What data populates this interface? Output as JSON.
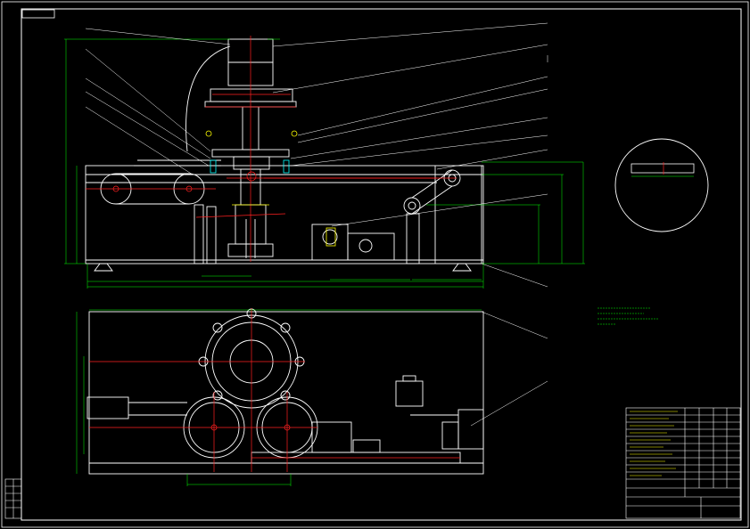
{
  "stamp_text": "",
  "section_note": "",
  "notes_title": "",
  "notes": [],
  "title_block": {
    "drawing_title": "",
    "drawing_number": ""
  },
  "dimensions": {
    "overall_width": "",
    "bottom_offset": "",
    "mid_offset": "",
    "right_offset": "",
    "height_total": "",
    "plan_width": ""
  },
  "colors": {
    "frame": "#ffffff",
    "drawing_line": "#ffffff",
    "center_line": "#ff2020",
    "dimension_line": "#00ff00",
    "leader_line": "#ffffff",
    "accent_yellow": "#ffff00",
    "accent_cyan": "#00ffff",
    "accent_magenta": "#ff00ff"
  }
}
